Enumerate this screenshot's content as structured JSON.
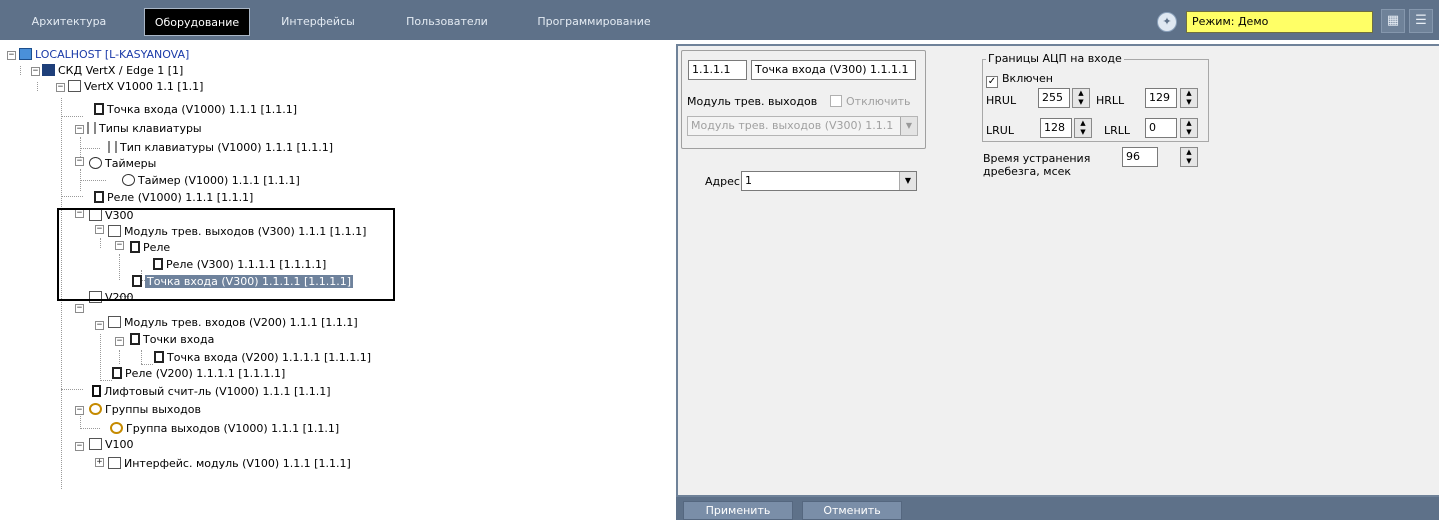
{
  "menu": {
    "tabs": [
      "Архитектура",
      "Оборудование",
      "Интерфейсы",
      "Пользователи",
      "Программирование"
    ],
    "mode": "Режим: Демо"
  },
  "tree": [
    {
      "label": "LOCALHOST [L-KASYANOVA]",
      "icon": "computer-icon"
    },
    {
      "label": "СКД VertX / Edge 1 [1]",
      "icon": "vertx-icon"
    },
    {
      "label": "VertX V1000 1.1 [1.1]",
      "icon": "module-icon"
    },
    {
      "label": "Точка входа (V1000) 1.1.1 [1.1.1]",
      "icon": "door-input-icon"
    },
    {
      "label": "Типы клавиатуры",
      "icon": "keyboard-icon"
    },
    {
      "label": "Тип клавиатуры (V1000) 1.1.1 [1.1.1]",
      "icon": "keyboard-icon"
    },
    {
      "label": "Таймеры",
      "icon": "timer-icon"
    },
    {
      "label": "Таймер (V1000) 1.1.1 [1.1.1]",
      "icon": "timer-icon"
    },
    {
      "label": "Реле (V1000) 1.1.1 [1.1.1]",
      "icon": "relay-icon"
    },
    {
      "label": "V300",
      "icon": "module-icon"
    },
    {
      "label": "Модуль трев. выходов (V300) 1.1.1 [1.1.1]",
      "icon": "module-icon"
    },
    {
      "label": "Реле",
      "icon": "relay-icon"
    },
    {
      "label": "Реле (V300) 1.1.1.1 [1.1.1.1]",
      "icon": "relay-icon"
    },
    {
      "label": "Точка входа (V300) 1.1.1.1 [1.1.1.1]",
      "icon": "door-input-icon"
    },
    {
      "label": "V200",
      "icon": "module-icon"
    },
    {
      "label": "Модуль трев. входов (V200) 1.1.1 [1.1.1]",
      "icon": "module-icon"
    },
    {
      "label": "Точки входа",
      "icon": "door-input-icon"
    },
    {
      "label": "Точка входа (V200) 1.1.1.1 [1.1.1.1]",
      "icon": "door-input-icon"
    },
    {
      "label": "Реле (V200) 1.1.1.1 [1.1.1.1]",
      "icon": "relay-icon"
    },
    {
      "label": "Лифтовый счит-ль (V1000) 1.1.1 [1.1.1]",
      "icon": "lift-reader-icon"
    },
    {
      "label": "Группы выходов",
      "icon": "output-group-icon"
    },
    {
      "label": "Группа выходов (V1000) 1.1.1 [1.1.1]",
      "icon": "output-group-icon"
    },
    {
      "label": "V100",
      "icon": "module-icon"
    },
    {
      "label": "Интерфейс. модуль (V100) 1.1.1 [1.1.1]",
      "icon": "module-icon"
    }
  ],
  "panel": {
    "object_id": "1.1.1.1",
    "object_name": "Точка входа (V300) 1.1.1.1",
    "parent_label": "Модуль трев. выходов",
    "disable_label": "Отключить",
    "parent_value": "Модуль трев. выходов (V300) 1.1.1",
    "address_label": "Адрес",
    "address_value": "1",
    "adc_title": "Границы АЦП на входе",
    "enabled_label": "Включен",
    "hrul_label": "HRUL",
    "hrul": "255",
    "hrll_label": "HRLL",
    "hrll": "129",
    "lrul_label": "LRUL",
    "lrul": "128",
    "lrll_label": "LRLL",
    "lrll": "0",
    "debounce_label_1": "Время устранения",
    "debounce_label_2": "дребезга, мсек",
    "debounce": "96"
  },
  "buttons": {
    "apply": "Применить",
    "cancel": "Отменить"
  },
  "colors": {
    "menubar": "#5e7189",
    "selection": "#6e829c",
    "mode_field": "#ffff66",
    "panel": "#f0f0f0"
  }
}
